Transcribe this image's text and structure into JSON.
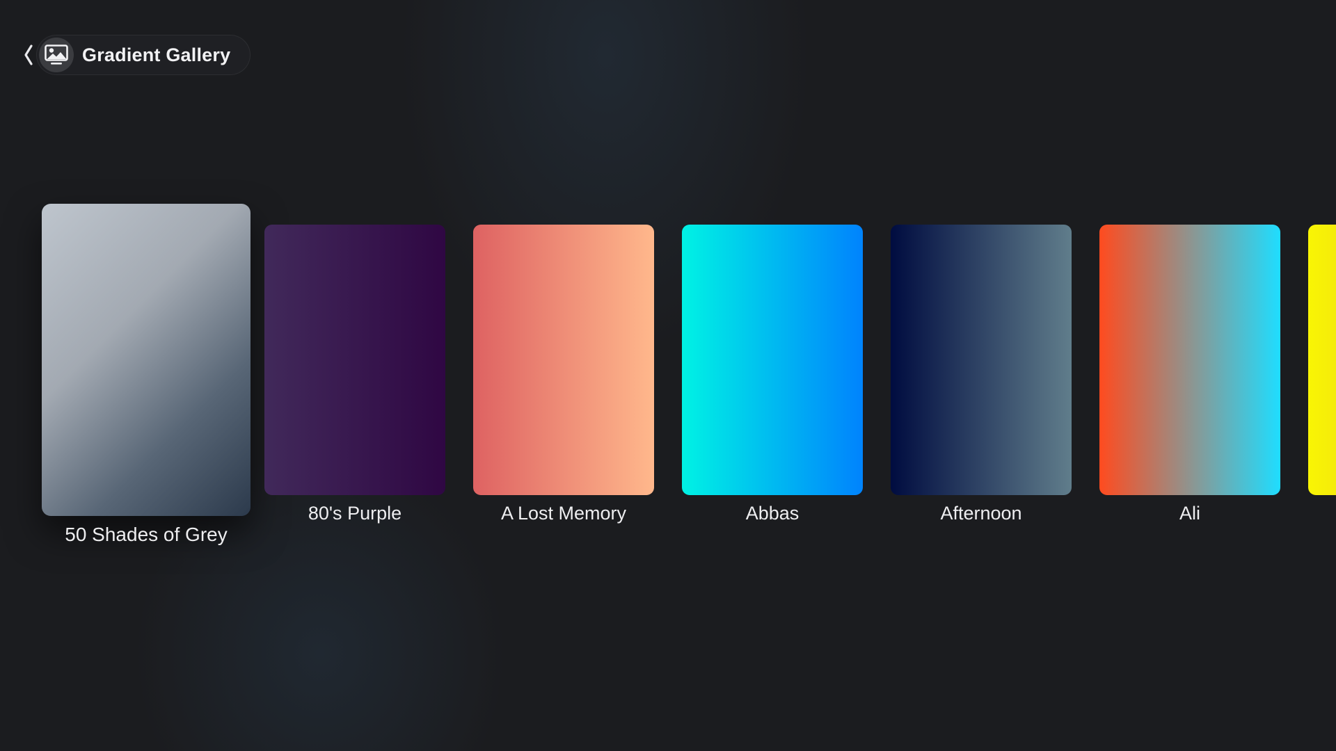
{
  "header": {
    "back_icon": "chevron-left-icon",
    "app_icon": "photo-frame-icon",
    "title": "Gradient Gallery"
  },
  "gallery": {
    "focused_index": 0,
    "items": [
      {
        "label": "50 Shades of Grey",
        "colors": [
          "#bdc3c7",
          "#2c3e50"
        ]
      },
      {
        "label": "80's Purple",
        "colors": [
          "#41295a",
          "#2f0743"
        ]
      },
      {
        "label": "A Lost Memory",
        "colors": [
          "#de6262",
          "#ffb88c"
        ]
      },
      {
        "label": "Abbas",
        "colors": [
          "#00f2e4",
          "#0083fd"
        ]
      },
      {
        "label": "Afternoon",
        "colors": [
          "#000c40",
          "#607d8b"
        ]
      },
      {
        "label": "Ali",
        "colors": [
          "#ff4b1f",
          "#1fddff"
        ]
      },
      {
        "label": "",
        "colors": [
          "#f9f504",
          "#f2e70d"
        ]
      }
    ]
  },
  "colors": {
    "background": "#1b1c1f",
    "text": "#eeeef0"
  }
}
